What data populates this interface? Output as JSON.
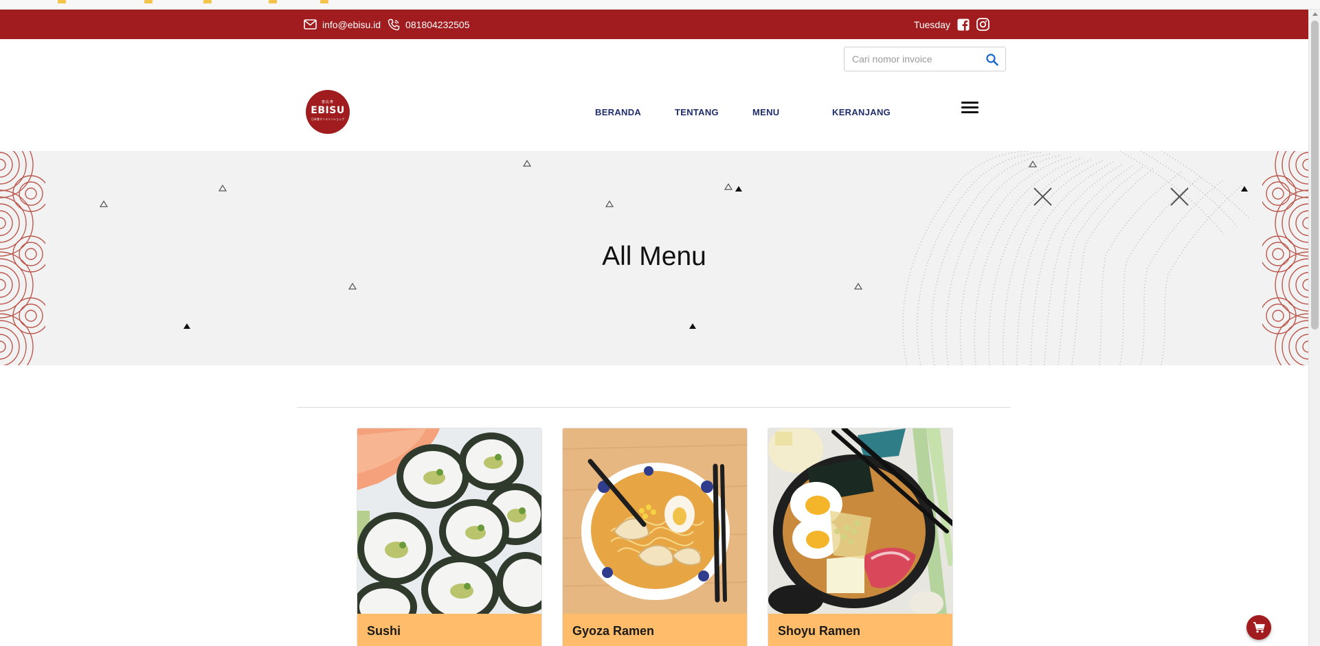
{
  "colors": {
    "brand_red": "#a01c1e",
    "nav_text": "#1f2d6b",
    "card_label_bg": "#ffbd6b",
    "hero_bg": "#f2f2f2"
  },
  "topbar": {
    "email": "info@ebisu.id",
    "phone": "081804232505",
    "day": "Tuesday",
    "icons": [
      "mail-icon",
      "phone-icon",
      "facebook-icon",
      "instagram-icon"
    ]
  },
  "search": {
    "placeholder": "Cari nomor invoice",
    "icon": "search-icon"
  },
  "logo": {
    "line1": "恵比寿",
    "brand": "EBISU",
    "line3": "日本食オンラインショップ"
  },
  "nav": {
    "items": [
      {
        "label": "BERANDA"
      },
      {
        "label": "TENTANG"
      },
      {
        "label": "MENU"
      },
      {
        "label": "KERANJANG"
      }
    ],
    "menu_icon": "hamburger-icon"
  },
  "hero": {
    "title": "All Menu"
  },
  "menu_items": [
    {
      "name": "Sushi"
    },
    {
      "name": "Gyoza Ramen"
    },
    {
      "name": "Shoyu Ramen"
    }
  ],
  "floating_cart": {
    "icon": "cart-icon"
  }
}
